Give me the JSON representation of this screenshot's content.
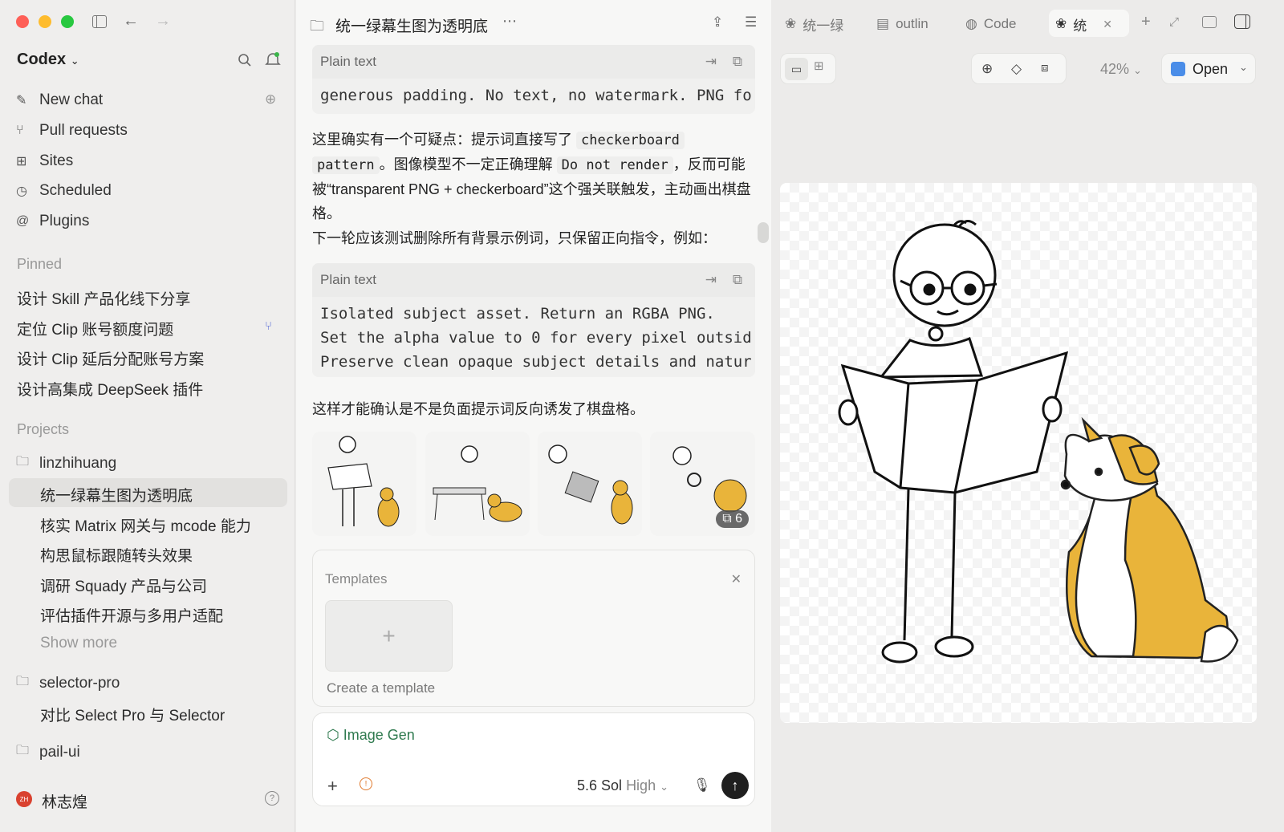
{
  "app": {
    "name": "Codex"
  },
  "sidebar": {
    "nav": [
      {
        "label": "New chat",
        "icon": "edit-icon"
      },
      {
        "label": "Pull requests",
        "icon": "pull-request-icon"
      },
      {
        "label": "Sites",
        "icon": "sites-icon"
      },
      {
        "label": "Scheduled",
        "icon": "clock-icon"
      },
      {
        "label": "Plugins",
        "icon": "plugin-icon"
      }
    ],
    "pinned_label": "Pinned",
    "pinned": [
      "设计 Skill 产品化线下分享",
      "定位 Clip 账号额度问题",
      "设计 Clip 延后分配账号方案",
      "设计高集成 DeepSeek 插件"
    ],
    "projects_label": "Projects",
    "projects": [
      {
        "name": "linzhihuang",
        "threads": [
          "统一绿幕生图为透明底",
          "核实 Matrix 网关与 mcode 能力",
          "构思鼠标跟随转头效果",
          "调研 Squady 产品与公司",
          "评估插件开源与多用户适配"
        ],
        "more": "Show more"
      },
      {
        "name": "selector-pro",
        "threads": [
          "对比 Select Pro 与 Selector"
        ]
      },
      {
        "name": "pail-ui",
        "threads": []
      }
    ],
    "user": {
      "name": "林志煌",
      "initials": "ZH"
    }
  },
  "center": {
    "title": "统一绿幕生图为透明底",
    "code1": {
      "label": "Plain text",
      "line": "generous padding. No text, no watermark. PNG fo"
    },
    "para1_a": "这里确实有一个可疑点：提示词直接写了",
    "para1_code1": "checkerboard",
    "para1_code2": "pattern",
    "para1_b": "。图像模型不一定正确理解",
    "para1_code3": "Do not render",
    "para1_c": "，反而可能被“transparent PNG + checkerboard”这个强关联触发，主动画出棋盘格。",
    "para2": "下一轮应该测试删除所有背景示例词，只保留正向指令，例如：",
    "code2": {
      "label": "Plain text",
      "lines": [
        "Isolated subject asset. Return an RGBA PNG.",
        "Set the alpha value to 0 for every pixel outsid",
        "Preserve clean opaque subject details and natur"
      ]
    },
    "para3": "这样才能确认是不是负面提示词反向诱发了棋盘格。",
    "image_count": "6",
    "templates": {
      "title": "Templates",
      "create": "Create a template"
    },
    "composer": {
      "plugin": "Image Gen",
      "model": "5.6 Sol",
      "effort": "High"
    }
  },
  "right": {
    "tabs": [
      "统一绿",
      "outlin",
      "Code",
      "统"
    ],
    "zoom": "42%",
    "open_label": "Open"
  }
}
